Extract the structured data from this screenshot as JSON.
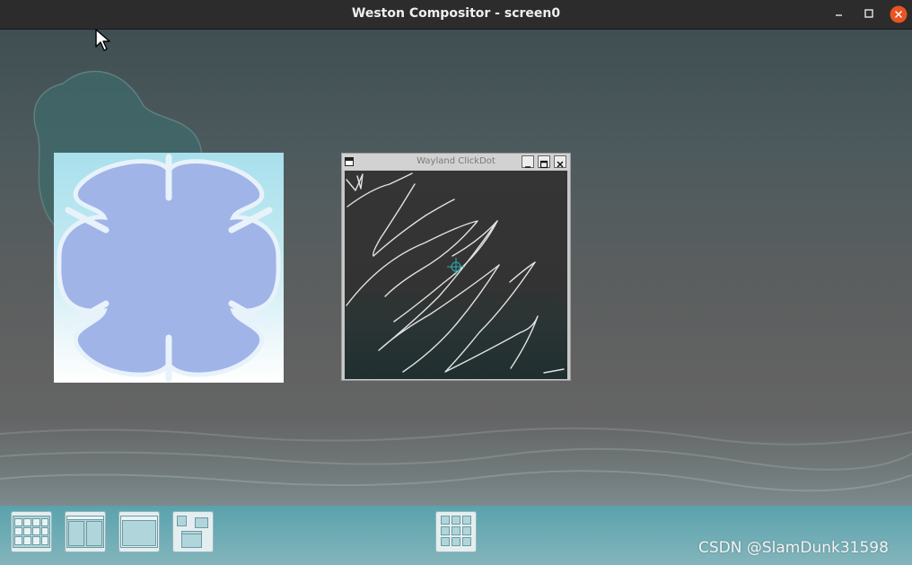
{
  "host_window": {
    "title": "Weston Compositor - screen0",
    "controls": [
      "minimize-icon",
      "maximize-icon",
      "close-icon"
    ],
    "close_color": "#e95420"
  },
  "desktop": {
    "windows": [
      {
        "id": "flower",
        "title": "",
        "icon": "flower-icon"
      },
      {
        "id": "clickdot",
        "title": "Wayland ClickDot"
      }
    ]
  },
  "panel": {
    "launchers": [
      {
        "name": "launcher-grid-2x3",
        "icon": "grid-icon"
      },
      {
        "name": "launcher-split-columns",
        "icon": "columns-icon"
      },
      {
        "name": "launcher-single-window",
        "icon": "window-icon"
      },
      {
        "name": "launcher-stacked-windows",
        "icon": "stacked-windows-icon"
      },
      {
        "name": "launcher-app-grid",
        "icon": "app-grid-icon"
      }
    ]
  },
  "watermark": "CSDN @SlamDunk31598",
  "colors": {
    "panel": "#5aa2ad",
    "flower_petal": "#a0b4e8",
    "flower_bg_top": "#a8e0ec",
    "clickdot_canvas": "#333333",
    "crosshair": "#2fb0b6"
  }
}
